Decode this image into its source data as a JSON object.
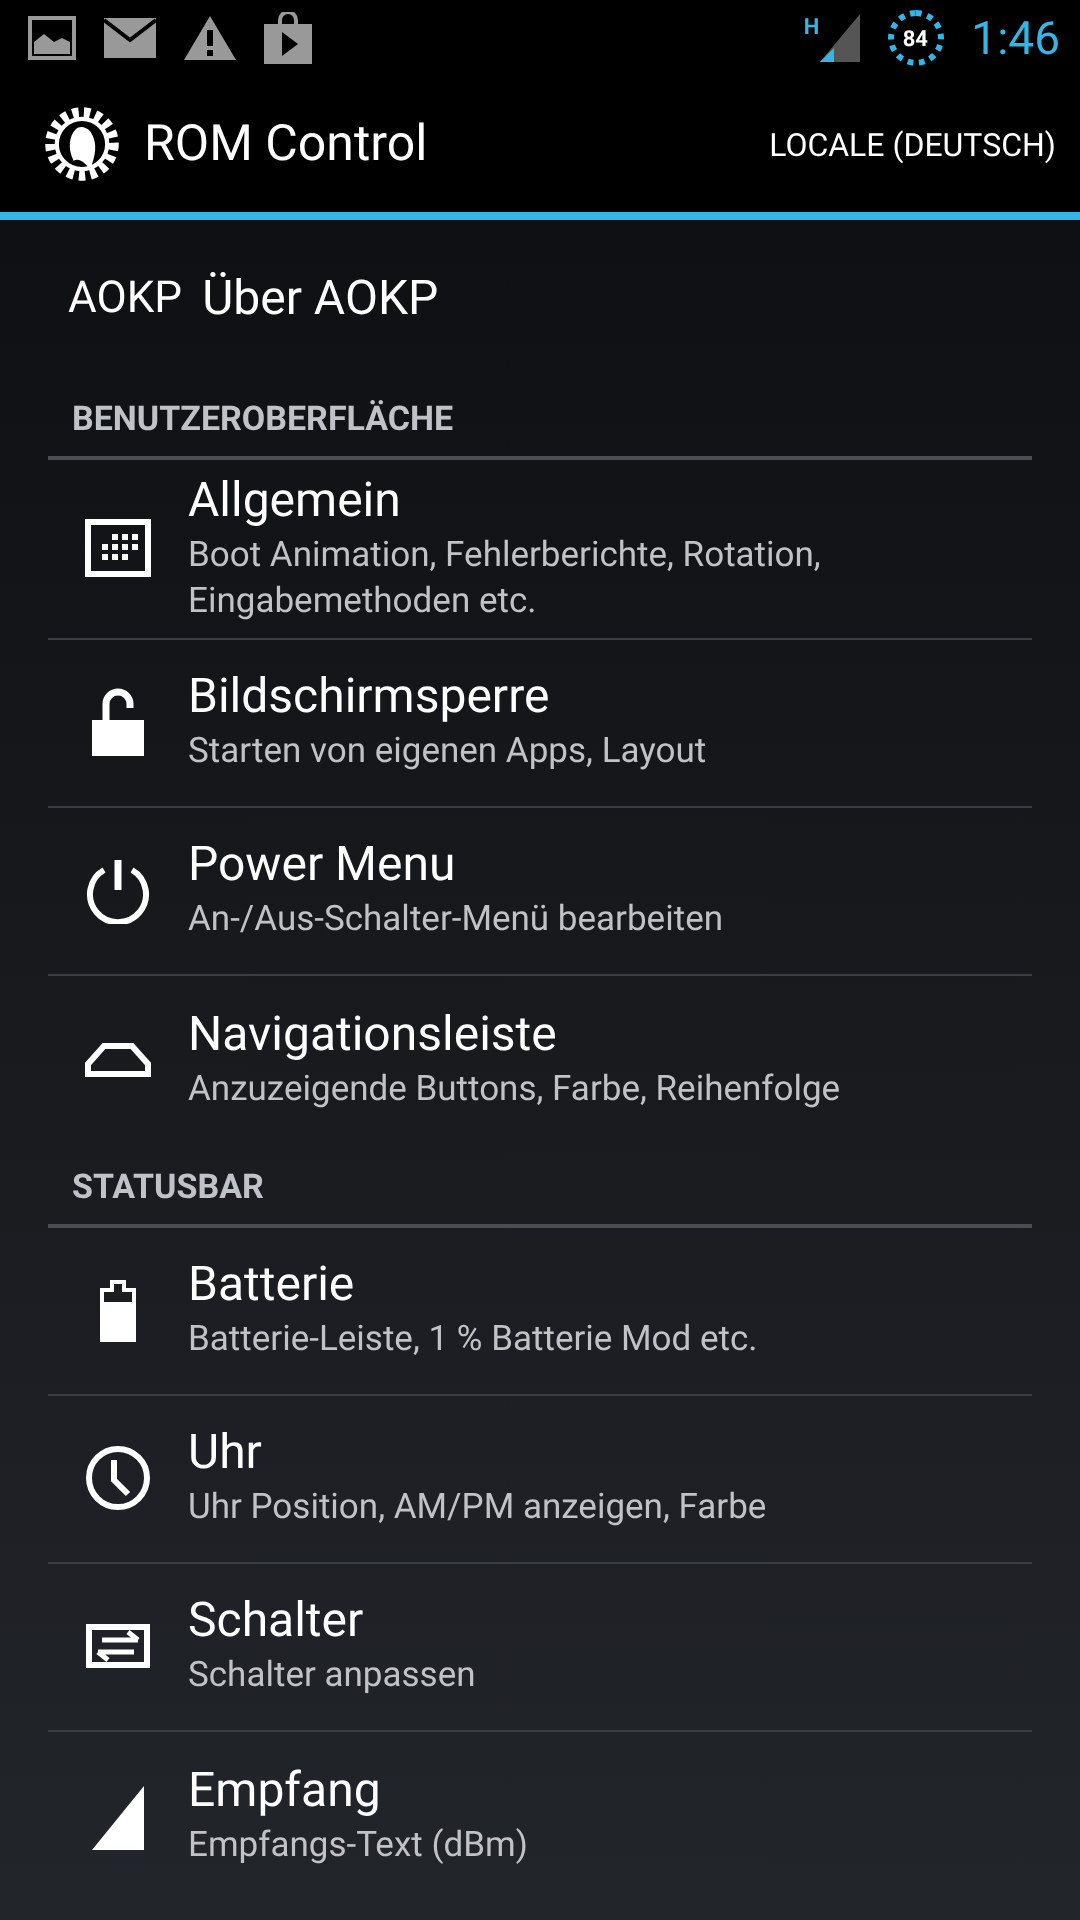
{
  "status_bar": {
    "network": "H",
    "battery": "84",
    "time": "1:46"
  },
  "action_bar": {
    "title": "ROM Control",
    "action": "LOCALE (DEUTSCH)"
  },
  "about": {
    "logo": "AOKP",
    "label": "Über AOKP"
  },
  "sections": [
    {
      "header": "BENUTZEROBERFLÄCHE",
      "items": [
        {
          "kind": "grid",
          "title": "Allgemein",
          "summary": "Boot Animation, Fehlerberichte, Rotation, Eingabemethoden etc."
        },
        {
          "kind": "lock",
          "title": "Bildschirmsperre",
          "summary": "Starten von eigenen Apps, Layout"
        },
        {
          "kind": "power",
          "title": "Power Menu",
          "summary": "An-/Aus-Schalter-Menü bearbeiten"
        },
        {
          "kind": "navbar",
          "title": "Navigationsleiste",
          "summary": "Anzuzeigende Buttons, Farbe, Reihenfolge"
        }
      ]
    },
    {
      "header": "STATUSBAR",
      "items": [
        {
          "kind": "battery",
          "title": "Batterie",
          "summary": "Batterie-Leiste, 1 % Batterie Mod etc."
        },
        {
          "kind": "clock",
          "title": "Uhr",
          "summary": "Uhr Position, AM/PM anzeigen, Farbe"
        },
        {
          "kind": "toggle",
          "title": "Schalter",
          "summary": "Schalter anpassen"
        },
        {
          "kind": "signal",
          "title": "Empfang",
          "summary": "Empfangs-Text (dBm)"
        }
      ]
    }
  ]
}
